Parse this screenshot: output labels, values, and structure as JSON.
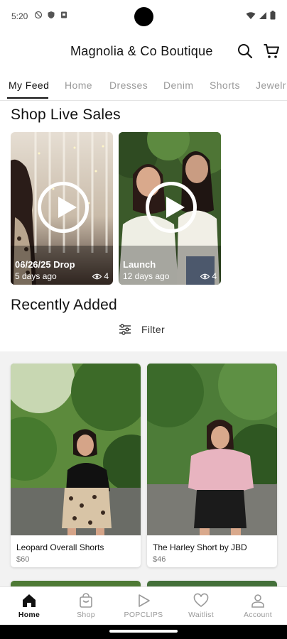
{
  "status": {
    "time": "5:20"
  },
  "header": {
    "store_title": "Magnolia & Co Boutique"
  },
  "tabs": [
    {
      "label": "My Feed",
      "active": true
    },
    {
      "label": "Home"
    },
    {
      "label": "Dresses"
    },
    {
      "label": "Denim"
    },
    {
      "label": "Shorts"
    },
    {
      "label": "Jewelr"
    }
  ],
  "live": {
    "title": "Shop Live Sales",
    "cards": [
      {
        "name": "06/26/25 Drop",
        "age": "5 days ago",
        "views": "4"
      },
      {
        "name": "Launch",
        "age": "12 days ago",
        "views": "4"
      }
    ]
  },
  "recent": {
    "title": "Recently Added",
    "filter_label": "Filter",
    "products": [
      {
        "name": "Leopard Overall Shorts",
        "price": "$60"
      },
      {
        "name": "The Harley Short by JBD",
        "price": "$46"
      }
    ]
  },
  "nav": [
    {
      "label": "Home",
      "icon": "home-icon",
      "active": true
    },
    {
      "label": "Shop",
      "icon": "shopping-bag-icon"
    },
    {
      "label": "POPCLIPS",
      "icon": "play-icon"
    },
    {
      "label": "Waitlist",
      "icon": "heart-icon"
    },
    {
      "label": "Account",
      "icon": "person-icon"
    }
  ],
  "colors": {
    "accent": "#111111",
    "muted": "#9a9a9a",
    "grid_bg": "#f2f2f2"
  }
}
